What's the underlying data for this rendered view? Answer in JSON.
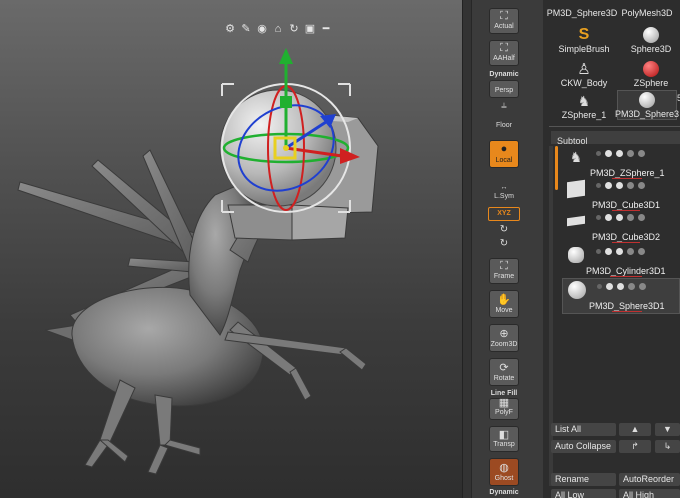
{
  "gizmo_toolbar": [
    "gear-icon",
    "pin-icon",
    "location-icon",
    "home-icon",
    "reset-icon",
    "lock-icon",
    "minus-icon"
  ],
  "shelf": {
    "actual": "Actual",
    "aahalf": "AAHalf",
    "dynamic_top": "Dynamic",
    "persp": "Persp",
    "floor": "Floor",
    "local": "Local",
    "lsym": "L.Sym",
    "xyz": "XYZ",
    "frame": "Frame",
    "move": "Move",
    "zoom3d": "Zoom3D",
    "rotate": "Rotate",
    "line_fill": "Line Fill",
    "polyf": "PolyF",
    "transp": "Transp",
    "ghost": "Ghost",
    "dynamic_bottom": "Dynamic"
  },
  "brushes": [
    {
      "label": "PM3D_Sphere3D"
    },
    {
      "label": "PolyMesh3D"
    },
    {
      "label": "SimpleBrush"
    },
    {
      "label": "Sphere3D"
    },
    {
      "label": "CKW_Body"
    },
    {
      "label": "ZSphere"
    },
    {
      "label": "ZSphere_1"
    },
    {
      "label": "PM3D_Sphere3"
    },
    {
      "label": "5"
    }
  ],
  "subtool": {
    "header": "Subtool",
    "items": [
      {
        "name": "PM3D_ZSphere_1"
      },
      {
        "name": "PM3D_Cube3D1"
      },
      {
        "name": "PM3D_Cube3D2"
      },
      {
        "name": "PM3D_Cylinder3D1"
      },
      {
        "name": "PM3D_Sphere3D1"
      }
    ]
  },
  "panel_buttons": {
    "list_all": "List All",
    "auto_collapse": "Auto Collapse",
    "rename": "Rename",
    "auto_reorder": "AutoReorder",
    "all_low": "All Low",
    "all_high": "All High"
  },
  "colors": {
    "accent": "#e8881c",
    "ghost": "#9c4a22",
    "gizmo_x": "#d02020",
    "gizmo_y": "#20b030",
    "gizmo_z": "#2040d0"
  }
}
